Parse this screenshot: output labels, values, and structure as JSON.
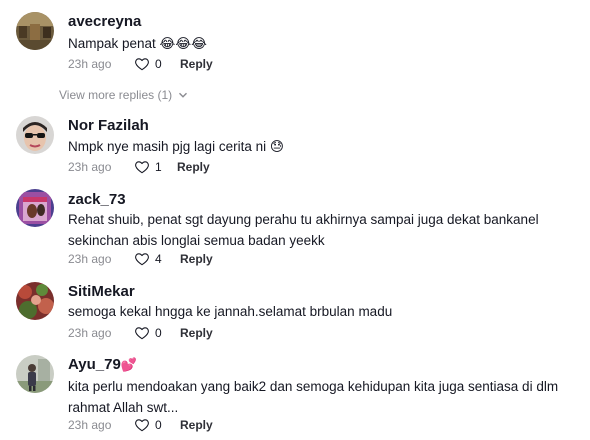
{
  "comments": [
    {
      "username": "avecreyna",
      "username_emoji": "",
      "text": "Nampak penat 😂😂😂",
      "time": "23h ago",
      "likes": "0",
      "reply_label": "Reply"
    },
    {
      "username": "Nor Fazilah",
      "username_emoji": "",
      "text": "Nmpk nye masih pjg lagi cerita ni 😓",
      "time": "23h ago",
      "likes": "1",
      "reply_label": "Reply"
    },
    {
      "username": "zack_73",
      "username_emoji": "",
      "text": "Rehat shuib, penat sgt dayung perahu tu akhirnya sampai juga dekat bankanel sekinchan abis longlai semua badan yeekk",
      "time": "23h ago",
      "likes": "4",
      "reply_label": "Reply"
    },
    {
      "username": "SitiMekar",
      "username_emoji": "",
      "text": "semoga kekal hngga ke jannah.selamat brbulan madu",
      "time": "23h ago",
      "likes": "0",
      "reply_label": "Reply"
    },
    {
      "username": "Ayu_79",
      "username_emoji": "💕",
      "text": "kita perlu mendoakan yang baik2 dan semoga kehidupan kita juga sentiasa di dlm rahmat Allah swt...",
      "time": "23h ago",
      "likes": "0",
      "reply_label": "Reply"
    }
  ],
  "view_more_replies": "View more replies (1)",
  "colors": {
    "text": "#161823",
    "secondary": "#8a8b91",
    "reply": "#2f3037"
  }
}
